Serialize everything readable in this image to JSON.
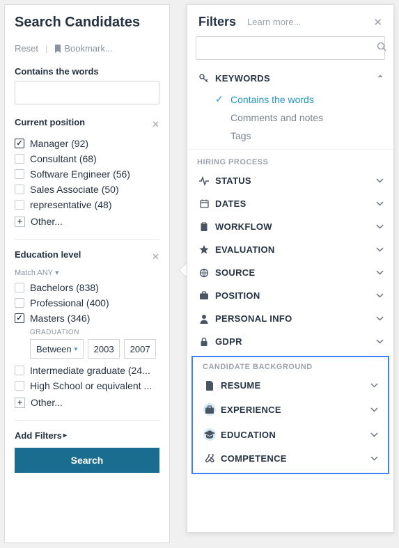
{
  "left": {
    "title": "Search Candidates",
    "reset": "Reset",
    "bookmark": "Bookmark...",
    "contains_label": "Contains the words",
    "current_position": {
      "label": "Current position",
      "items": [
        {
          "label": "Manager (92)",
          "checked": true
        },
        {
          "label": "Consultant (68)",
          "checked": false
        },
        {
          "label": "Software Engineer (56)",
          "checked": false
        },
        {
          "label": "Sales Associate (50)",
          "checked": false
        },
        {
          "label": "representative (48)",
          "checked": false
        }
      ],
      "other": "Other..."
    },
    "education": {
      "label": "Education level",
      "match_any": "Match ANY",
      "items_top": [
        {
          "label": "Bachelors (838)",
          "checked": false
        },
        {
          "label": "Professional (400)",
          "checked": false
        },
        {
          "label": "Masters (346)",
          "checked": true
        }
      ],
      "graduation_label": "GRADUATION",
      "between": "Between",
      "year_from": "2003",
      "year_to": "2007",
      "items_bottom": [
        {
          "label": "Intermediate graduate (24...",
          "checked": false
        },
        {
          "label": "High School or equivalent ...",
          "checked": false
        }
      ],
      "other": "Other..."
    },
    "add_filters": "Add Filters",
    "search_btn": "Search"
  },
  "right": {
    "title": "Filters",
    "learn_more": "Learn more...",
    "keywords": {
      "label": "KEYWORDS",
      "subs": [
        {
          "label": "Contains the words",
          "active": true
        },
        {
          "label": "Comments and notes",
          "active": false
        },
        {
          "label": "Tags",
          "active": false
        }
      ]
    },
    "hiring_heading": "HIRING PROCESS",
    "hiring": [
      {
        "icon": "pulse",
        "label": "STATUS"
      },
      {
        "icon": "calendar",
        "label": "DATES"
      },
      {
        "icon": "clipboard",
        "label": "WORKFLOW"
      },
      {
        "icon": "star",
        "label": "EVALUATION"
      },
      {
        "icon": "source",
        "label": "SOURCE"
      },
      {
        "icon": "briefcase",
        "label": "POSITION"
      },
      {
        "icon": "person",
        "label": "PERSONAL INFO"
      },
      {
        "icon": "lock",
        "label": "GDPR"
      }
    ],
    "background_heading": "CANDIDATE BACKGROUND",
    "background": [
      {
        "icon": "doc",
        "label": "RESUME",
        "hl": false
      },
      {
        "icon": "briefcase",
        "label": "EXPERIENCE",
        "hl": true
      },
      {
        "icon": "gradcap",
        "label": "EDUCATION",
        "hl": true
      },
      {
        "icon": "wrench",
        "label": "COMPETENCE",
        "hl": false
      }
    ]
  }
}
